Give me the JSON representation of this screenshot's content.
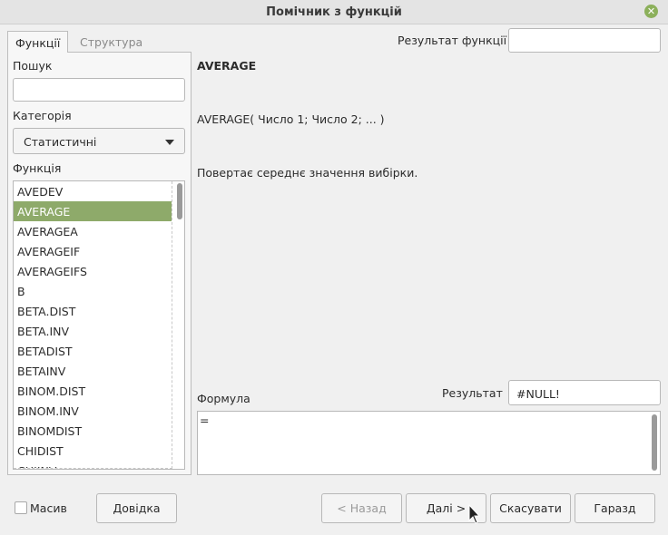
{
  "window": {
    "title": "Помічник з функцій"
  },
  "tabs": [
    {
      "label": "Функції"
    },
    {
      "label": "Структура"
    }
  ],
  "left": {
    "search_label": "Пошук",
    "search_value": "",
    "category_label": "Категорія",
    "category_value": "Статистичні",
    "function_label": "Функція",
    "functions": [
      "AVEDEV",
      "AVERAGE",
      "AVERAGEA",
      "AVERAGEIF",
      "AVERAGEIFS",
      "B",
      "BETA.DIST",
      "BETA.INV",
      "BETADIST",
      "BETAINV",
      "BINOM.DIST",
      "BINOM.INV",
      "BINOMDIST",
      "CHIDIST",
      "CHIINV"
    ],
    "selected_function": "AVERAGE"
  },
  "right": {
    "function_result_label": "Результат функції",
    "function_result_value": "",
    "func_name": "AVERAGE",
    "syntax": "AVERAGE( Число 1; Число 2; ... )",
    "description": "Повертає середнє значення вибірки.",
    "formula_label": "Формула",
    "result_label": "Результат",
    "result_value": "#NULL!",
    "formula_value": "="
  },
  "footer": {
    "array_label": "Масив",
    "help_label": "Довідка",
    "back_label": "< Назад",
    "next_label": "Далі >",
    "cancel_label": "Скасувати",
    "ok_label": "Гаразд"
  },
  "colors": {
    "selection": "#8eaa6a",
    "close": "#8cb05b"
  }
}
